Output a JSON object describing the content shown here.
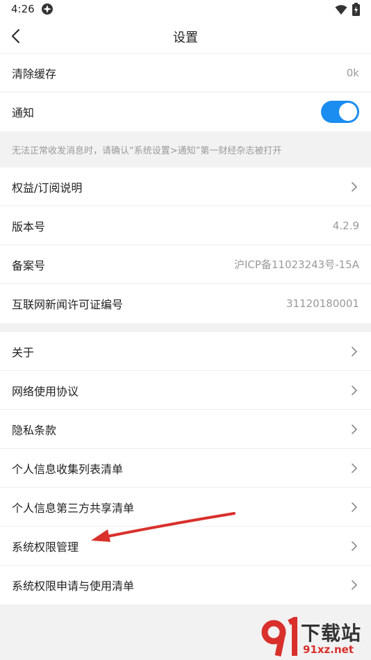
{
  "status_bar": {
    "time": "4:26"
  },
  "nav": {
    "title": "设置"
  },
  "section1": {
    "clear_cache_label": "清除缓存",
    "clear_cache_value": "0k",
    "notify_label": "通知",
    "notify_on": true
  },
  "hint": "无法正常收发消息时，请确认“系统设置>通知”第一财经杂志被打开",
  "section2": [
    {
      "label": "权益/订阅说明",
      "value": "",
      "chevron": true
    },
    {
      "label": "版本号",
      "value": "4.2.9",
      "chevron": false
    },
    {
      "label": "备案号",
      "value": "沪ICP备11023243号-15A",
      "chevron": false
    },
    {
      "label": "互联网新闻许可证编号",
      "value": "31120180001",
      "chevron": false
    }
  ],
  "section3": [
    {
      "label": "关于"
    },
    {
      "label": "网络使用协议"
    },
    {
      "label": "隐私条款"
    },
    {
      "label": "个人信息收集列表清单"
    },
    {
      "label": "个人信息第三方共享清单"
    },
    {
      "label": "系统权限管理"
    },
    {
      "label": "系统权限申请与使用清单"
    }
  ],
  "watermark": {
    "line1": "下载站",
    "line2": "91xz.net"
  },
  "colors": {
    "accent": "#1b8cf0",
    "annotation_arrow": "#d9302c"
  }
}
